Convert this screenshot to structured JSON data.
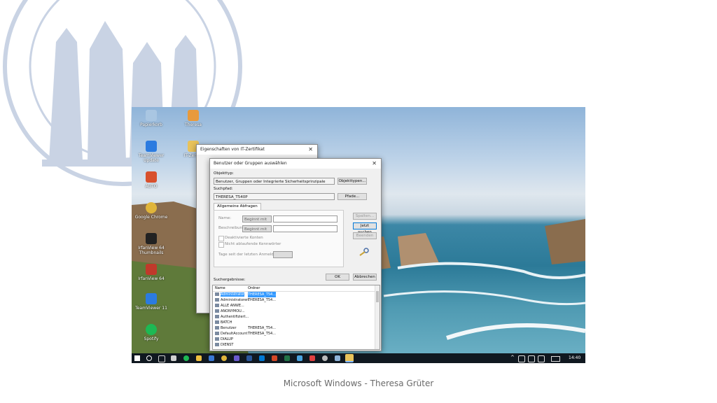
{
  "desktop_icons": [
    {
      "label": "Papierkorb",
      "name": "recycle-bin-icon",
      "color": "#a9c6e2"
    },
    {
      "label": "Theresa",
      "name": "user-folder-icon",
      "color": "#e89a3c"
    },
    {
      "label": "TeamViewer Update",
      "name": "teamviewer-update-icon",
      "color": "#2b7be0"
    },
    {
      "label": "IT-Zerti...",
      "name": "certificate-folder-icon",
      "color": "#e8c25a"
    },
    {
      "label": "AUTO",
      "name": "auto-icon",
      "color": "#d8502c"
    },
    {
      "label": "Google Chrome",
      "name": "chrome-icon",
      "color": "#e0b53a"
    },
    {
      "label": "IrfanView 64 Thumbnails",
      "name": "irfanview-thumbnails-icon",
      "color": "#222222"
    },
    {
      "label": "IrfanView 64",
      "name": "irfanview-icon",
      "color": "#c0392b"
    },
    {
      "label": "TeamViewer 11",
      "name": "teamviewer-icon",
      "color": "#2b7be0"
    },
    {
      "label": "Spotify",
      "name": "spotify-icon",
      "color": "#1db954"
    }
  ],
  "bg_window": {
    "title": "Eigenschaften von IT-Zertifikat"
  },
  "dialog": {
    "title": "Benutzer oder Gruppen auswählen",
    "objecttype_label": "Objekttyp:",
    "objecttype_value": "Benutzer, Gruppen oder Integrierte Sicherheitsprinzipale",
    "objecttypes_button": "Objekttypen...",
    "searchpath_label": "Suchpfad:",
    "searchpath_value": "THERESA_T540P",
    "paths_button": "Pfade...",
    "tab_label": "Allgemeine Abfragen",
    "name_label": "Name:",
    "name_mode": "Beginnt mit",
    "description_label": "Beschreibung:",
    "description_mode": "Beginnt mit",
    "columns_button": "Spalten...",
    "search_now_button": "Jetzt suchen",
    "stop_button": "Beenden",
    "disabled_accounts_label": "Deaktivierte Konten",
    "nonexpiring_label": "Nicht ablaufende Kennwörter",
    "days_label": "Tage seit der letzten Anmeldung:",
    "ok_button": "OK",
    "cancel_button": "Abbrechen",
    "results_label": "Suchergebnisse:",
    "col_name": "Name",
    "col_folder": "Ordner",
    "results": [
      {
        "name": "Administrator",
        "folder": "THERESA_T54..."
      },
      {
        "name": "Administratoren",
        "folder": "THERESA_T54..."
      },
      {
        "name": "ALLE ANWE...",
        "folder": ""
      },
      {
        "name": "ANONYMOU...",
        "folder": ""
      },
      {
        "name": "Authentifiziert...",
        "folder": ""
      },
      {
        "name": "BATCH",
        "folder": ""
      },
      {
        "name": "Benutzer",
        "folder": "THERESA_T54..."
      },
      {
        "name": "DefaultAccount",
        "folder": "THERESA_T54..."
      },
      {
        "name": "DIALUP",
        "folder": ""
      },
      {
        "name": "DIENST",
        "folder": ""
      }
    ]
  },
  "taskbar": {
    "clock": "14:40"
  },
  "footer": "Microsoft Windows - Theresa Grüter",
  "colors": {
    "selection": "#3399ff",
    "taskbar": "#101820",
    "accent": "#0078d7"
  }
}
